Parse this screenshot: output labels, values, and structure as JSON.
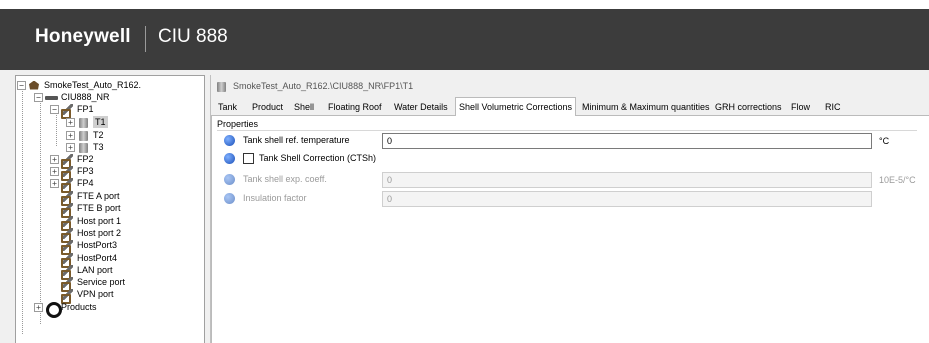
{
  "header": {
    "brand": "Honeywell",
    "product": "CIU 888"
  },
  "tree": {
    "root": "SmokeTest_Auto_R162.",
    "ciu": "CIU888_NR",
    "fp1": "FP1",
    "t1": "T1",
    "t2": "T2",
    "t3": "T3",
    "fp2": "FP2",
    "fp3": "FP3",
    "fp4": "FP4",
    "ports": [
      "FTE A port",
      "FTE B port",
      "Host port 1",
      "Host port 2",
      "HostPort3",
      "HostPort4",
      "LAN port",
      "Service port",
      "VPN port"
    ],
    "products": "Products",
    "expand_plus": "+",
    "expand_minus": "−"
  },
  "panel": {
    "path": "SmokeTest_Auto_R162.\\CIU888_NR\\FP1\\T1",
    "tabs": [
      "Tank",
      "Product",
      "Shell",
      "Floating Roof",
      "Water Details",
      "Shell Volumetric Corrections",
      "Minimum & Maximum quantities",
      "GRH corrections",
      "Flow",
      "RIC"
    ],
    "active_tab": "Shell Volumetric Corrections",
    "section": "Properties",
    "ref_temp_label": "Tank shell ref. temperature",
    "ref_temp_value": "0",
    "ref_temp_unit": "°C",
    "ctsh_label": "Tank Shell Correction (CTSh)",
    "ctsh_checked": false,
    "exp_coeff_label": "Tank shell exp. coeff.",
    "exp_coeff_value": "0",
    "exp_coeff_unit": "10E-5/°C",
    "insulation_label": "Insulation factor",
    "insulation_value": "0"
  },
  "colors": {
    "header_bg": "#3c3c3c",
    "info_icon": "#1a4fb8"
  }
}
